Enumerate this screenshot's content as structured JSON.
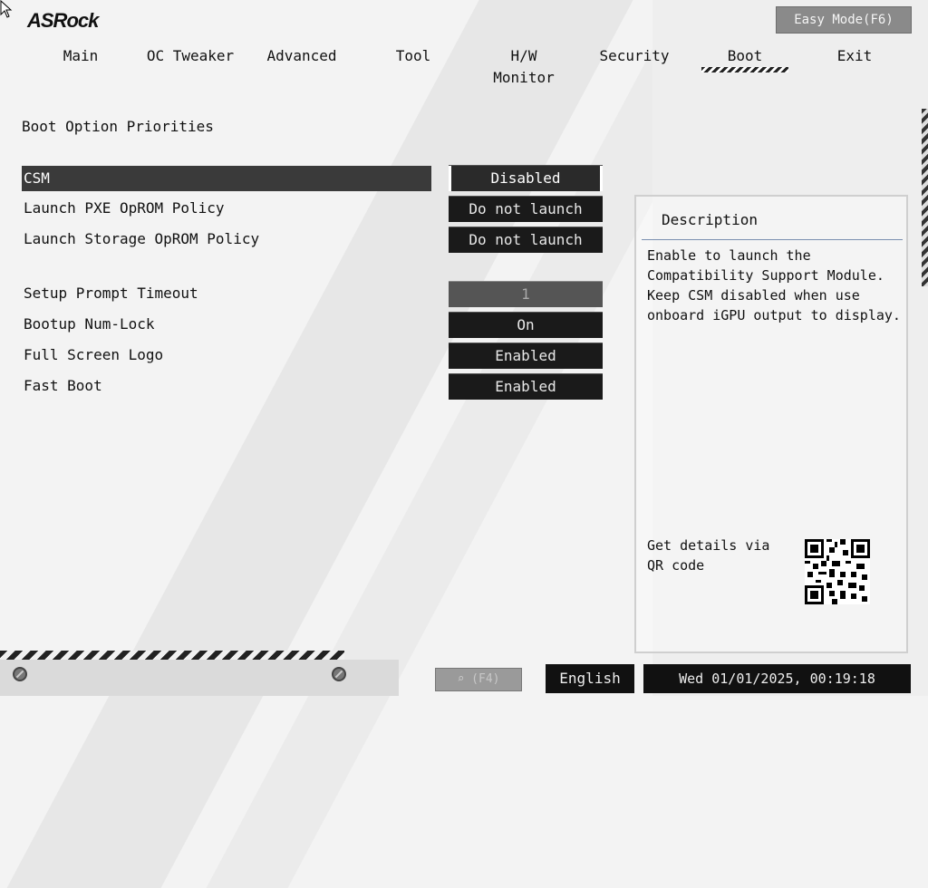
{
  "header": {
    "brand": "ASRock",
    "easy_mode_label": "Easy Mode(F6)"
  },
  "tabs": [
    {
      "label": "Main"
    },
    {
      "label": "OC Tweaker"
    },
    {
      "label": "Advanced"
    },
    {
      "label": "Tool"
    },
    {
      "label": "H/W Monitor"
    },
    {
      "label": "Security"
    },
    {
      "label": "Boot",
      "active": true
    },
    {
      "label": "Exit"
    }
  ],
  "main": {
    "section_title": "Boot Option Priorities",
    "settings": [
      {
        "label": "CSM",
        "value": "Disabled",
        "selected": true
      },
      {
        "label": "Launch PXE OpROM Policy",
        "value": "Do not launch"
      },
      {
        "label": "Launch Storage OpROM Policy",
        "value": "Do not launch"
      },
      {
        "label": "Setup Prompt Timeout",
        "value": "1",
        "disabled": true
      },
      {
        "label": "Bootup Num-Lock",
        "value": "On"
      },
      {
        "label": "Full Screen Logo",
        "value": "Enabled"
      },
      {
        "label": "Fast Boot",
        "value": "Enabled"
      }
    ]
  },
  "description": {
    "title": "Description",
    "text": "Enable to launch the\nCompatibility Support Module.\nKeep CSM disabled when use\nonboard iGPU output to display.",
    "qr_label": "Get details via QR code"
  },
  "footer": {
    "search_label": "(F4)",
    "language": "English",
    "datetime": "Wed 01/01/2025, 00:19:18"
  },
  "icons": {
    "search": "search-icon",
    "qr": "qr-code-icon",
    "cursor": "mouse-cursor-icon"
  }
}
